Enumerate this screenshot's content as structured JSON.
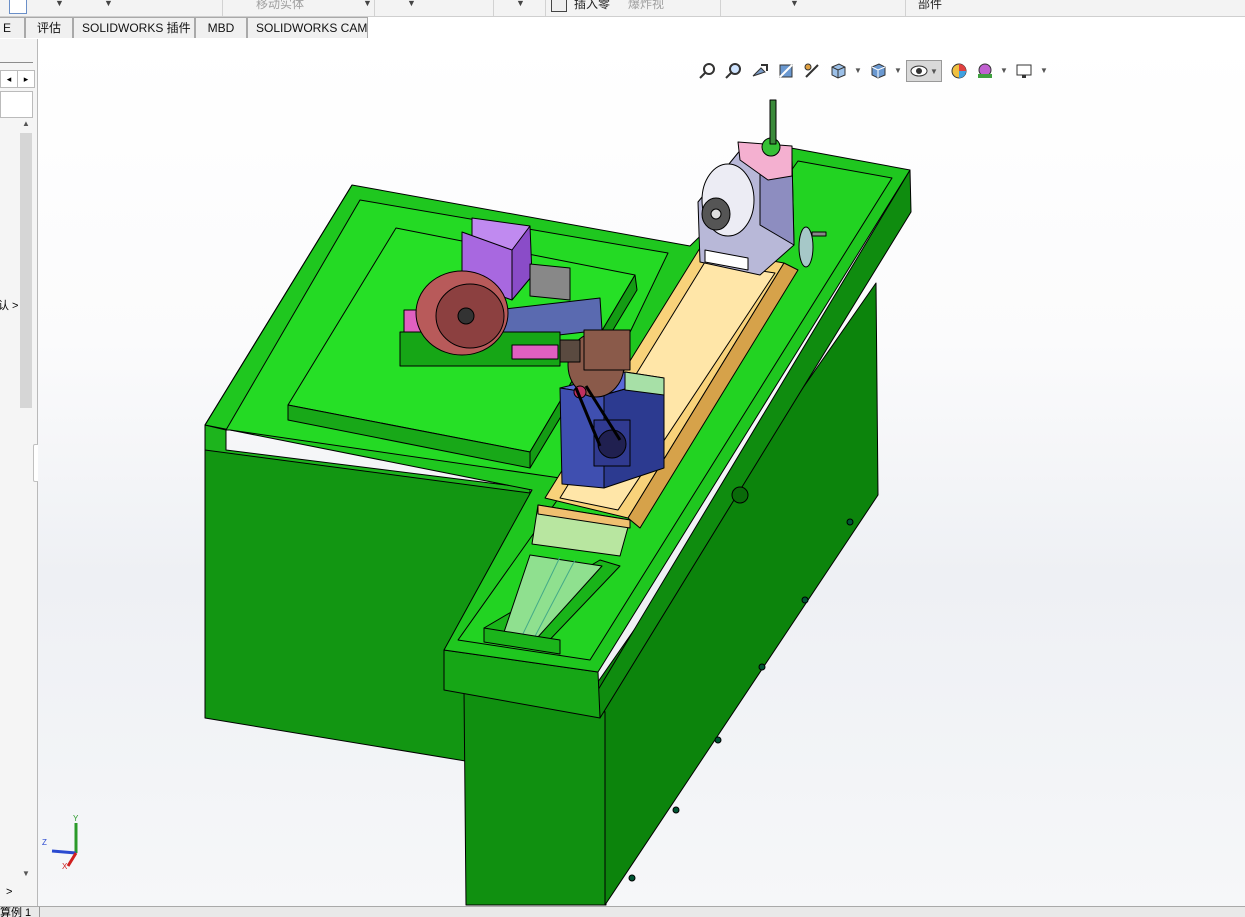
{
  "ribbon": {
    "move_body_label": "移动实体",
    "insert_part_label": "插入零",
    "unknown_label": "爆炸视",
    "parts_label": "部件"
  },
  "tabs": [
    {
      "label": "E"
    },
    {
      "label": "评估"
    },
    {
      "label": "SOLIDWORKS 插件"
    },
    {
      "label": "MBD"
    },
    {
      "label": "SOLIDWORKS CAM"
    }
  ],
  "left_panel": {
    "partial_text": "认 >",
    "nav_left": "◂",
    "nav_right": "▸",
    "scroll_up": "▲",
    "scroll_down": "▼",
    "expand": ">"
  },
  "heads_up_toolbar": {
    "icons": [
      "zoom-to-fit-icon",
      "zoom-to-area-icon",
      "previous-view-icon",
      "section-view-icon",
      "dynamic-annotation-icon",
      "view-orientation-icon",
      "display-style-icon",
      "hide-show-items-icon",
      "edit-appearance-icon",
      "apply-scene-icon",
      "view-settings-icon"
    ]
  },
  "triad": {
    "x_label": "X",
    "y_label": "Y",
    "z_label": "Z"
  },
  "status": {
    "text": "算例 1"
  },
  "colors": {
    "machine_green": "#1ec81e",
    "machine_green_dark": "#0a7a0a",
    "machine_green_top": "#22e622",
    "slide_yellow": "#f8d27a",
    "purple": "#b87ae8",
    "blue_block": "#3f4fb0",
    "wheel_red": "#b85a5a"
  }
}
